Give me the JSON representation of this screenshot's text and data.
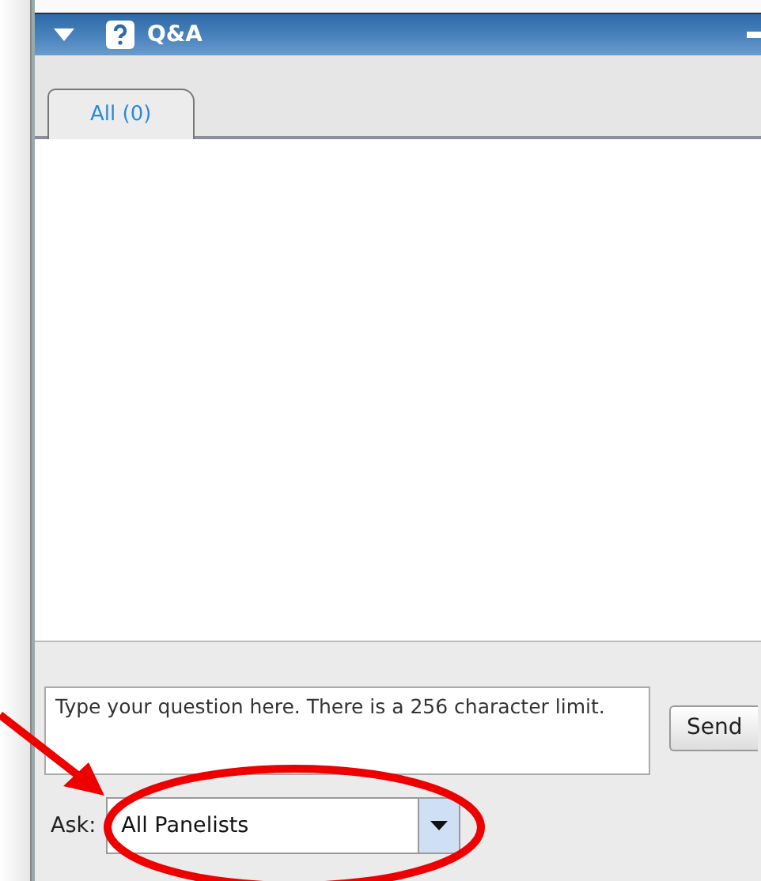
{
  "panel": {
    "title": "Q&A"
  },
  "tabs": [
    {
      "label": "All (0)",
      "selected": true
    }
  ],
  "question": {
    "placeholder": "Type your question here. There is a 256 character limit."
  },
  "send_button": "Send",
  "ask": {
    "label": "Ask:",
    "value": "All Panelists"
  }
}
